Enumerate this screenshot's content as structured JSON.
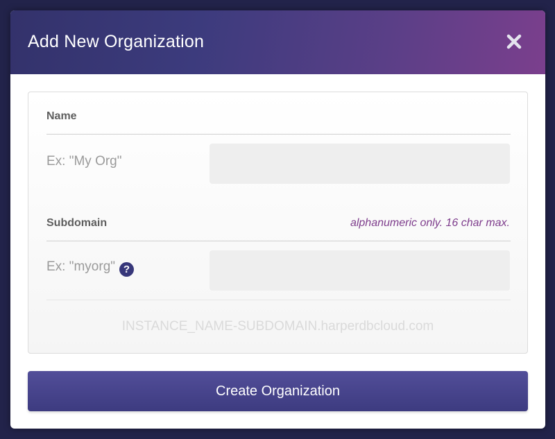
{
  "modal": {
    "title": "Add New Organization",
    "close_icon": "close-icon"
  },
  "form": {
    "name": {
      "label": "Name",
      "example": "Ex: \"My Org\"",
      "value": ""
    },
    "subdomain": {
      "label": "Subdomain",
      "hint": "alphanumeric only. 16 char max.",
      "example": "Ex: \"myorg\"",
      "help_icon": "question-circle-icon",
      "value": ""
    },
    "url_preview": "INSTANCE_NAME-SUBDOMAIN.harperdbcloud.com"
  },
  "actions": {
    "create_label": "Create Organization"
  },
  "colors": {
    "header_gradient_start": "#33326b",
    "header_gradient_end": "#7b3f8d",
    "accent": "#3d3b80",
    "hint": "#7e3d8c"
  }
}
